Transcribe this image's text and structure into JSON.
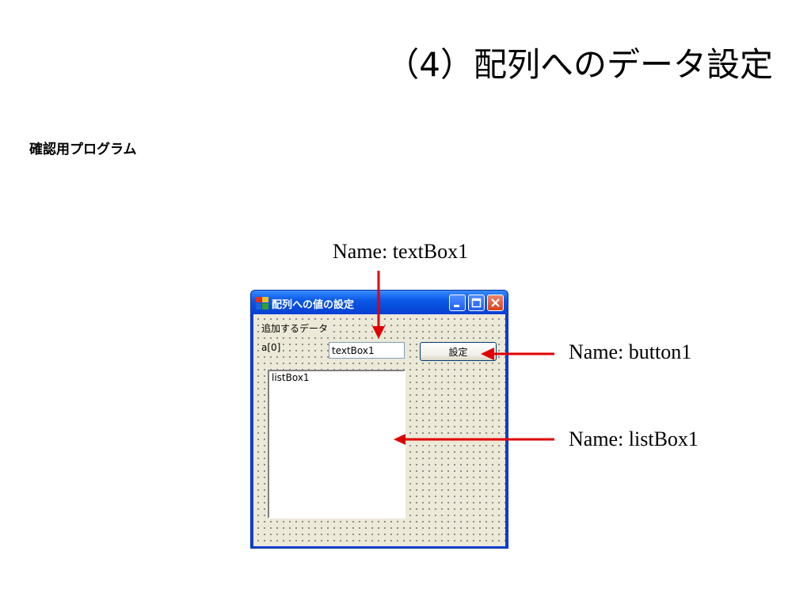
{
  "slide": {
    "title": "（4）配列へのデータ設定",
    "subtitle": "確認用プログラム"
  },
  "callouts": {
    "textbox": "Name: textBox1",
    "button": "Name: button1",
    "listbox": "Name: listBox1"
  },
  "window": {
    "title": "配列への値の設定",
    "label_add_data": "追加するデータ",
    "label_index": "a[0]",
    "textbox_value": "textBox1",
    "button_label": "設定",
    "listbox_items": [
      "listBox1"
    ]
  },
  "colors": {
    "arrow": "#e00000",
    "titlebar": "#0a5ae8"
  }
}
